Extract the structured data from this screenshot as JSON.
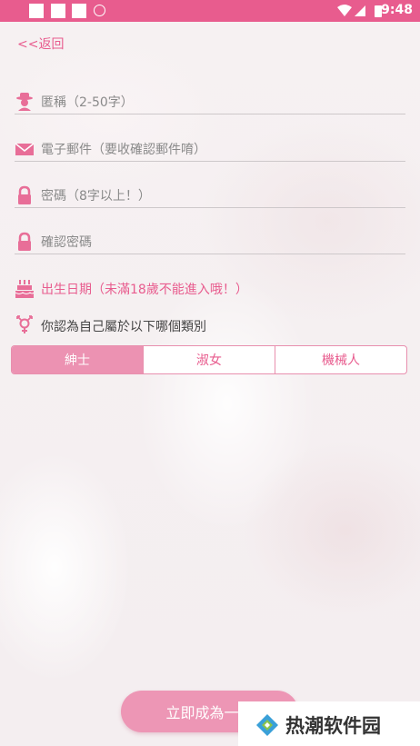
{
  "status_bar": {
    "time": "9:48",
    "bg_color": "#e85c8e"
  },
  "nav": {
    "back_label": "<<返回"
  },
  "form": {
    "nickname_placeholder": "匿稱（2-50字）",
    "email_placeholder": "電子郵件（要收確認郵件唷）",
    "password_placeholder": "密碼（8字以上！）",
    "confirm_password_placeholder": "確認密碼",
    "birthday_label": "出生日期（未滿18歲不能進入哦！）",
    "gender_question": "你認為自己屬於以下哪個類別",
    "gender_options": [
      "紳士",
      "淑女",
      "機械人"
    ],
    "gender_selected": "紳士"
  },
  "submit_label": "立即成為一位",
  "watermark": {
    "text": "热潮软件园"
  },
  "colors": {
    "accent": "#e85c8e",
    "button": "#ed96b5"
  }
}
